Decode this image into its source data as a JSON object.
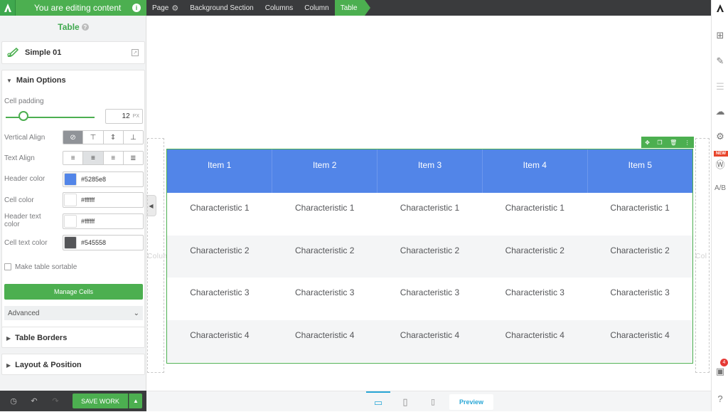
{
  "topbar": {
    "editing_label": "You are editing content",
    "info_icon": "i",
    "breadcrumbs": [
      "Page",
      "Background Section",
      "Columns",
      "Column",
      "Table"
    ]
  },
  "panel": {
    "title": "Table",
    "preset_name": "Simple 01",
    "main_options_title": "Main Options",
    "cell_padding_label": "Cell padding",
    "cell_padding_value": "12",
    "cell_padding_unit": "PX",
    "cell_padding_fraction": 0.2,
    "vertical_align_label": "Vertical Align",
    "text_align_label": "Text Align",
    "header_color_label": "Header color",
    "header_color_value": "#5285e8",
    "cell_color_label": "Cell color",
    "cell_color_value": "#ffffff",
    "header_text_color_label": "Header text color",
    "header_text_color_value": "#ffffff",
    "cell_text_color_label": "Cell text color",
    "cell_text_color_value": "#545558",
    "sortable_label": "Make table sortable",
    "manage_cells_label": "Manage Cells",
    "advanced_label": "Advanced",
    "table_borders_title": "Table Borders",
    "layout_position_title": "Layout & Position"
  },
  "footer": {
    "save_label": "SAVE WORK",
    "preview_label": "Preview"
  },
  "rightbar": {
    "new_badge": "NEW",
    "notification_count": "4",
    "ab_label": "A/B"
  },
  "canvas": {
    "column_word_left": "Column",
    "column_word_right": "Col",
    "headers": [
      "Item 1",
      "Item 2",
      "Item 3",
      "Item 4",
      "Item 5"
    ],
    "rows": [
      [
        "Characteristic 1",
        "Characteristic 1",
        "Characteristic 1",
        "Characteristic 1",
        "Characteristic 1"
      ],
      [
        "Characteristic 2",
        "Characteristic 2",
        "Characteristic 2",
        "Characteristic 2",
        "Characteristic 2"
      ],
      [
        "Characteristic 3",
        "Characteristic 3",
        "Characteristic 3",
        "Characteristic 3",
        "Characteristic 3"
      ],
      [
        "Characteristic 4",
        "Characteristic 4",
        "Characteristic 4",
        "Characteristic 4",
        "Characteristic 4"
      ]
    ]
  },
  "colors": {
    "brand_green": "#4caf50",
    "header_bg": "#5285e8",
    "accent_blue": "#2aa7d6"
  }
}
